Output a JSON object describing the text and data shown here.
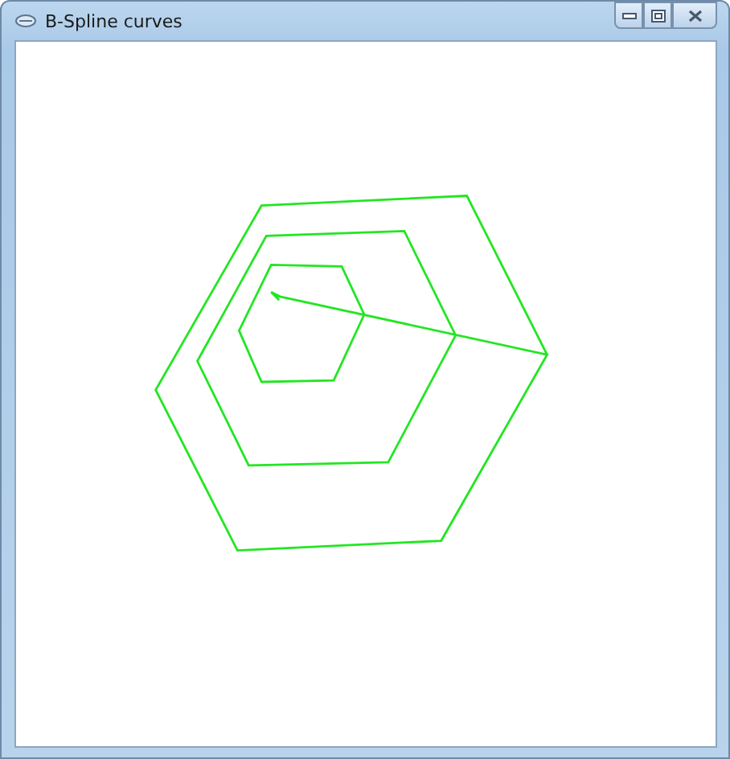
{
  "window": {
    "title": "B-Spline curves"
  }
}
